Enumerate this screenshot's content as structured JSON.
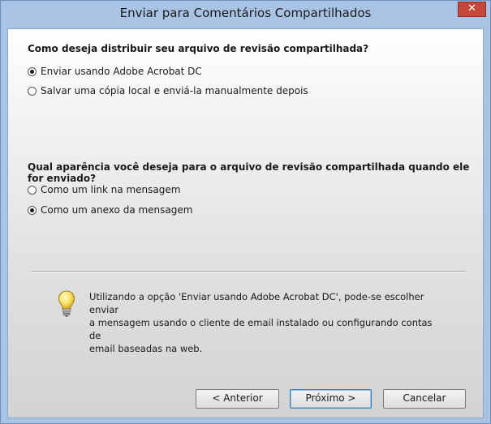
{
  "window": {
    "title": "Enviar para Comentários Compartilhados",
    "close_label": "✕"
  },
  "section1": {
    "question": "Como deseja distribuir seu arquivo de revisão compartilhada?",
    "options": [
      {
        "label": "Enviar usando Adobe Acrobat DC",
        "checked": true
      },
      {
        "label": "Salvar uma cópia local e enviá-la manualmente depois",
        "checked": false
      }
    ]
  },
  "section2": {
    "question": "Qual aparência você deseja para o arquivo de revisão compartilhada quando ele for enviado?",
    "options": [
      {
        "label": "Como um link na mensagem",
        "checked": false
      },
      {
        "label": "Como um anexo da mensagem",
        "checked": true
      }
    ]
  },
  "info": {
    "icon": "lightbulb-icon",
    "lines": [
      "Utilizando a opção 'Enviar usando Adobe Acrobat DC', pode-se escolher enviar",
      "a mensagem usando o cliente de email instalado ou configurando contas de",
      "email baseadas na web."
    ]
  },
  "buttons": {
    "back": "< Anterior",
    "next": "Próximo >",
    "cancel": "Cancelar"
  },
  "colors": {
    "frame": "#a9c3e4",
    "close": "#c7463a",
    "primary_border": "#3c7fb1"
  }
}
